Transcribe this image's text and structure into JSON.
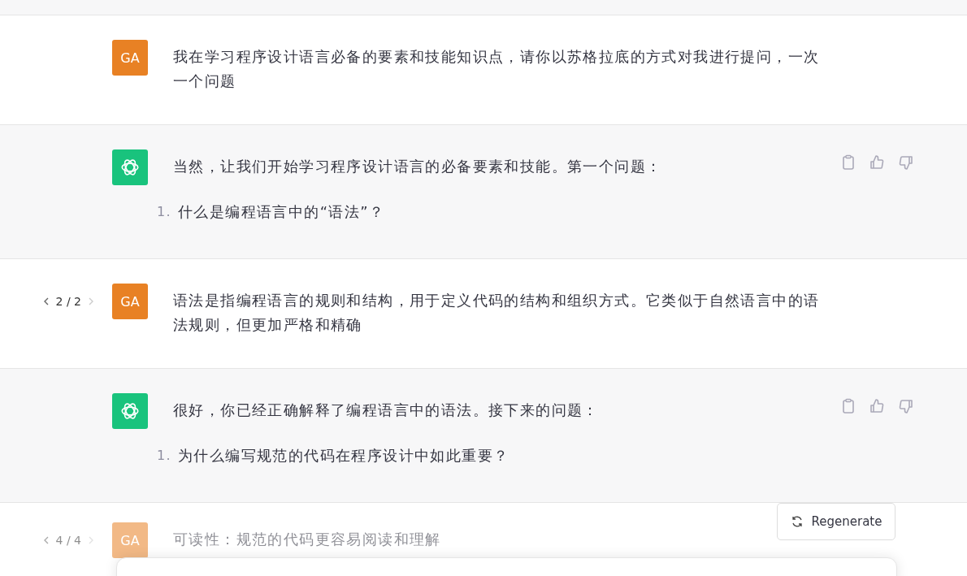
{
  "messages": [
    {
      "kind": "user",
      "avatar": "GA",
      "text": "我在学习程序设计语言必备的要素和技能知识点，请你以苏格拉底的方式对我进行提问，一次一个问题"
    },
    {
      "kind": "assistant",
      "text": "当然，让我们开始学习程序设计语言的必备要素和技能。第一个问题：",
      "list": [
        {
          "number": "1.",
          "text": "什么是编程语言中的“语法”？"
        }
      ]
    },
    {
      "kind": "user",
      "avatar": "GA",
      "pager": "2 / 2",
      "text": "语法是指编程语言的规则和结构，用于定义代码的结构和组织方式。它类似于自然语言中的语法规则，但更加严格和精确"
    },
    {
      "kind": "assistant",
      "text": "很好，你已经正确解释了编程语言中的语法。接下来的问题：",
      "list": [
        {
          "number": "1.",
          "text": "为什么编写规范的代码在程序设计中如此重要？"
        }
      ]
    },
    {
      "kind": "user",
      "avatar": "GA",
      "pager": "4 / 4",
      "faded": true,
      "text": "可读性：规范的代码更容易阅读和理解"
    }
  ],
  "regenerate_button": "Regenerate"
}
